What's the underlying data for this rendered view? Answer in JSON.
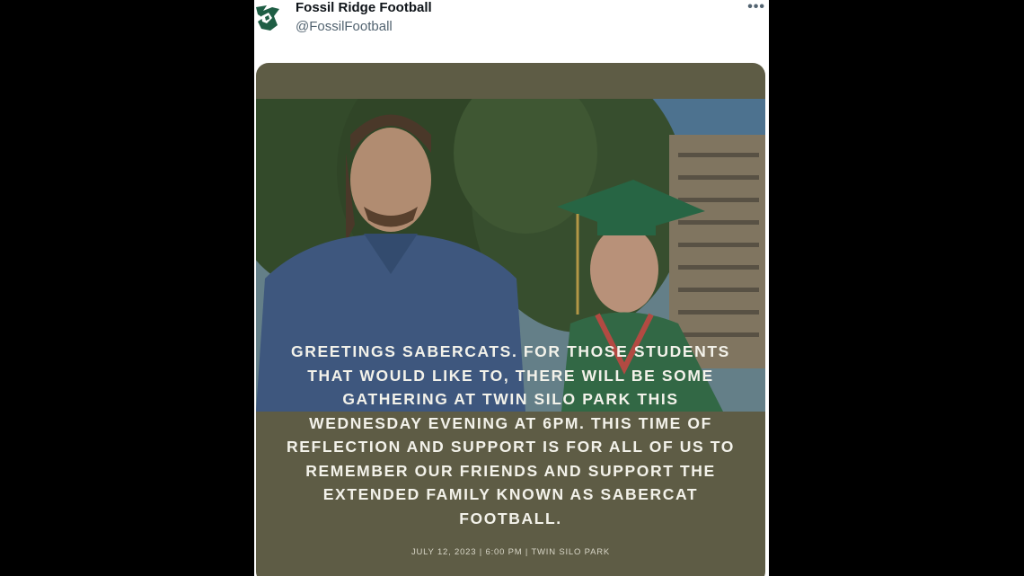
{
  "tweet": {
    "display_name": "Fossil Ridge Football",
    "handle": "@FossilFootball",
    "more_icon": "more-icon",
    "avatar_icon": "sabercat-logo-icon"
  },
  "post_image": {
    "message_lines": [
      "GREETINGS SABERCATS. FOR THOSE STUDENTS",
      "THAT WOULD LIKE TO, THERE WILL BE SOME",
      "GATHERING AT TWIN SILO PARK THIS",
      "WEDNESDAY EVENING AT 6PM. THIS TIME OF",
      "REFLECTION AND SUPPORT IS FOR ALL OF US TO",
      "REMEMBER OUR FRIENDS AND SUPPORT THE",
      "EXTENDED FAMILY KNOWN AS SABERCAT",
      "FOOTBALL."
    ],
    "event_details": "JULY 12, 2023 | 6:00 PM | TWIN SILO PARK"
  },
  "colors": {
    "card_background": "#5e5c45",
    "text": "#f3f2ea",
    "page_background": "#000000"
  }
}
